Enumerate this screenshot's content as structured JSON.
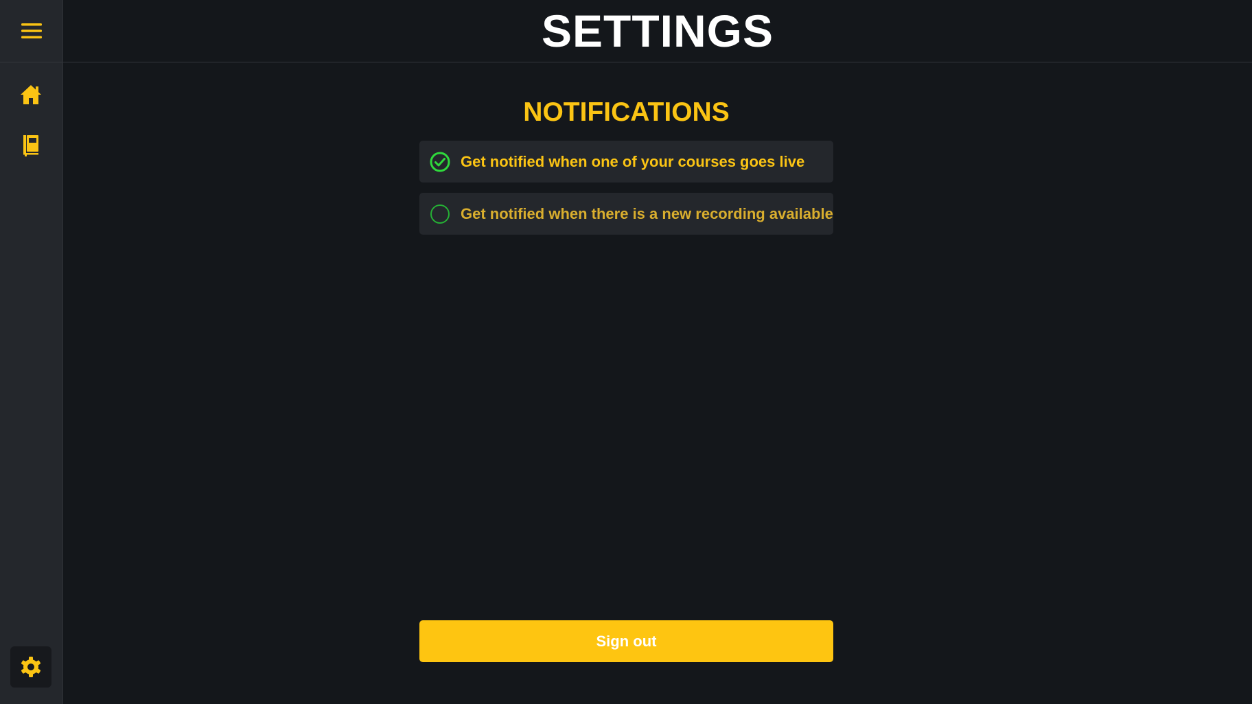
{
  "colors": {
    "background": "#14171b",
    "sidebar": "#24272c",
    "accent": "#fbc414",
    "check_green": "#2fd93c",
    "button": "#fec511"
  },
  "sidebar": {
    "menu_icon": "hamburger-menu-icon",
    "items": [
      {
        "icon": "home-icon",
        "active": false
      },
      {
        "icon": "course-book-icon",
        "active": false
      },
      {
        "icon": "gear-icon",
        "active": true
      }
    ]
  },
  "header": {
    "title": "SETTINGS"
  },
  "notifications": {
    "title": "NOTIFICATIONS",
    "options": [
      {
        "label": "Get notified when one of your courses goes live",
        "checked": true
      },
      {
        "label": "Get notified when there is a new recording available",
        "checked": false
      }
    ]
  },
  "signout": {
    "label": "Sign out"
  }
}
